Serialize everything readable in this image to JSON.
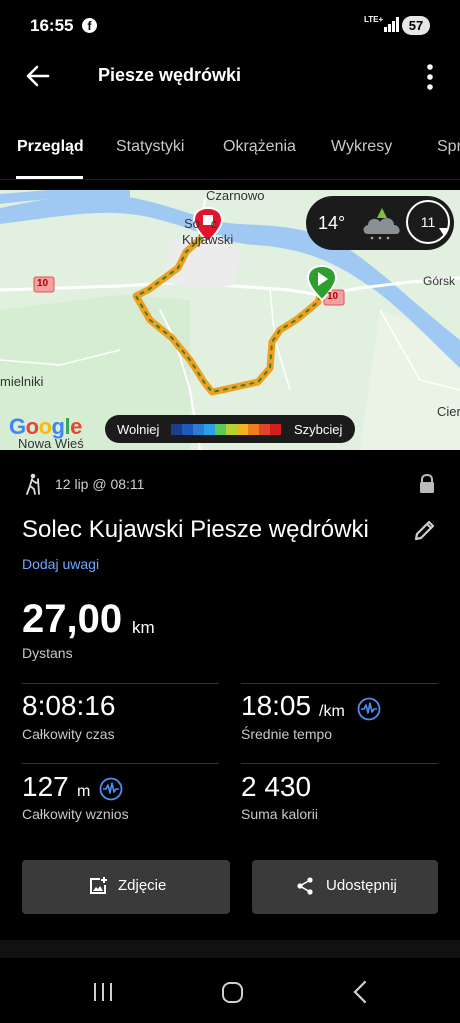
{
  "status_bar": {
    "time": "16:55",
    "facebook_icon": "f",
    "network": "LTE+",
    "battery": "57"
  },
  "app_bar": {
    "title": "Piesze wędrówki",
    "back_icon": "arrow-left-icon",
    "menu_icon": "more-vertical-icon"
  },
  "tabs": [
    {
      "label": "Przegląd",
      "active": true
    },
    {
      "label": "Statystyki",
      "active": false
    },
    {
      "label": "Okrążenia",
      "active": false
    },
    {
      "label": "Wykresy",
      "active": false
    },
    {
      "label": "Spr",
      "active": false
    }
  ],
  "map": {
    "place_labels": {
      "czarnowo": "Czarnowo",
      "solec_line1": "So   c",
      "solec_line2": "Kujawski",
      "gorsk": "Górsk",
      "mielniki": "mielniki",
      "nowa_wies": "Nowa Wieś",
      "cier": "Cier"
    },
    "road_badges": [
      "10",
      "10"
    ],
    "weather": {
      "temperature": "14°",
      "wind": "11",
      "icon": "cloud-icon"
    },
    "legend": {
      "slow": "Wolniej",
      "fast": "Szybciej",
      "colors": [
        "#1e3c8c",
        "#1e5abe",
        "#2d7dd2",
        "#2aa0e6",
        "#5ac85a",
        "#b4d232",
        "#f0b41e",
        "#f07d1e",
        "#e04628",
        "#d21e1e"
      ]
    },
    "google": "Google",
    "route_colors": {
      "fast": "#f0a020",
      "slow": "#3a7d2a",
      "start_marker": "#e3132c",
      "end_marker": "#2e9e2e"
    }
  },
  "activity": {
    "date": "12 lip @ 08:11",
    "title": "Solec Kujawski Piesze wędrówki",
    "add_notes": "Dodaj uwagi",
    "distance": {
      "value": "27,00",
      "unit": "km",
      "label": "Dystans"
    },
    "stats": [
      {
        "value": "8:08:16",
        "unit": "",
        "label": "Całkowity czas"
      },
      {
        "value": "18:05",
        "unit": "/km",
        "label": "Średnie tempo"
      },
      {
        "value": "127",
        "unit": "m",
        "label": "Całkowity wznios"
      },
      {
        "value": "2 430",
        "unit": "",
        "label": "Suma kalorii"
      }
    ]
  },
  "buttons": {
    "photo": "Zdjęcie",
    "share": "Udostępnij"
  },
  "colors": {
    "background": "#000000",
    "link": "#6ea8fe",
    "button_bg": "#3a3a3a",
    "pulse_icon": "#4f8ff0"
  }
}
